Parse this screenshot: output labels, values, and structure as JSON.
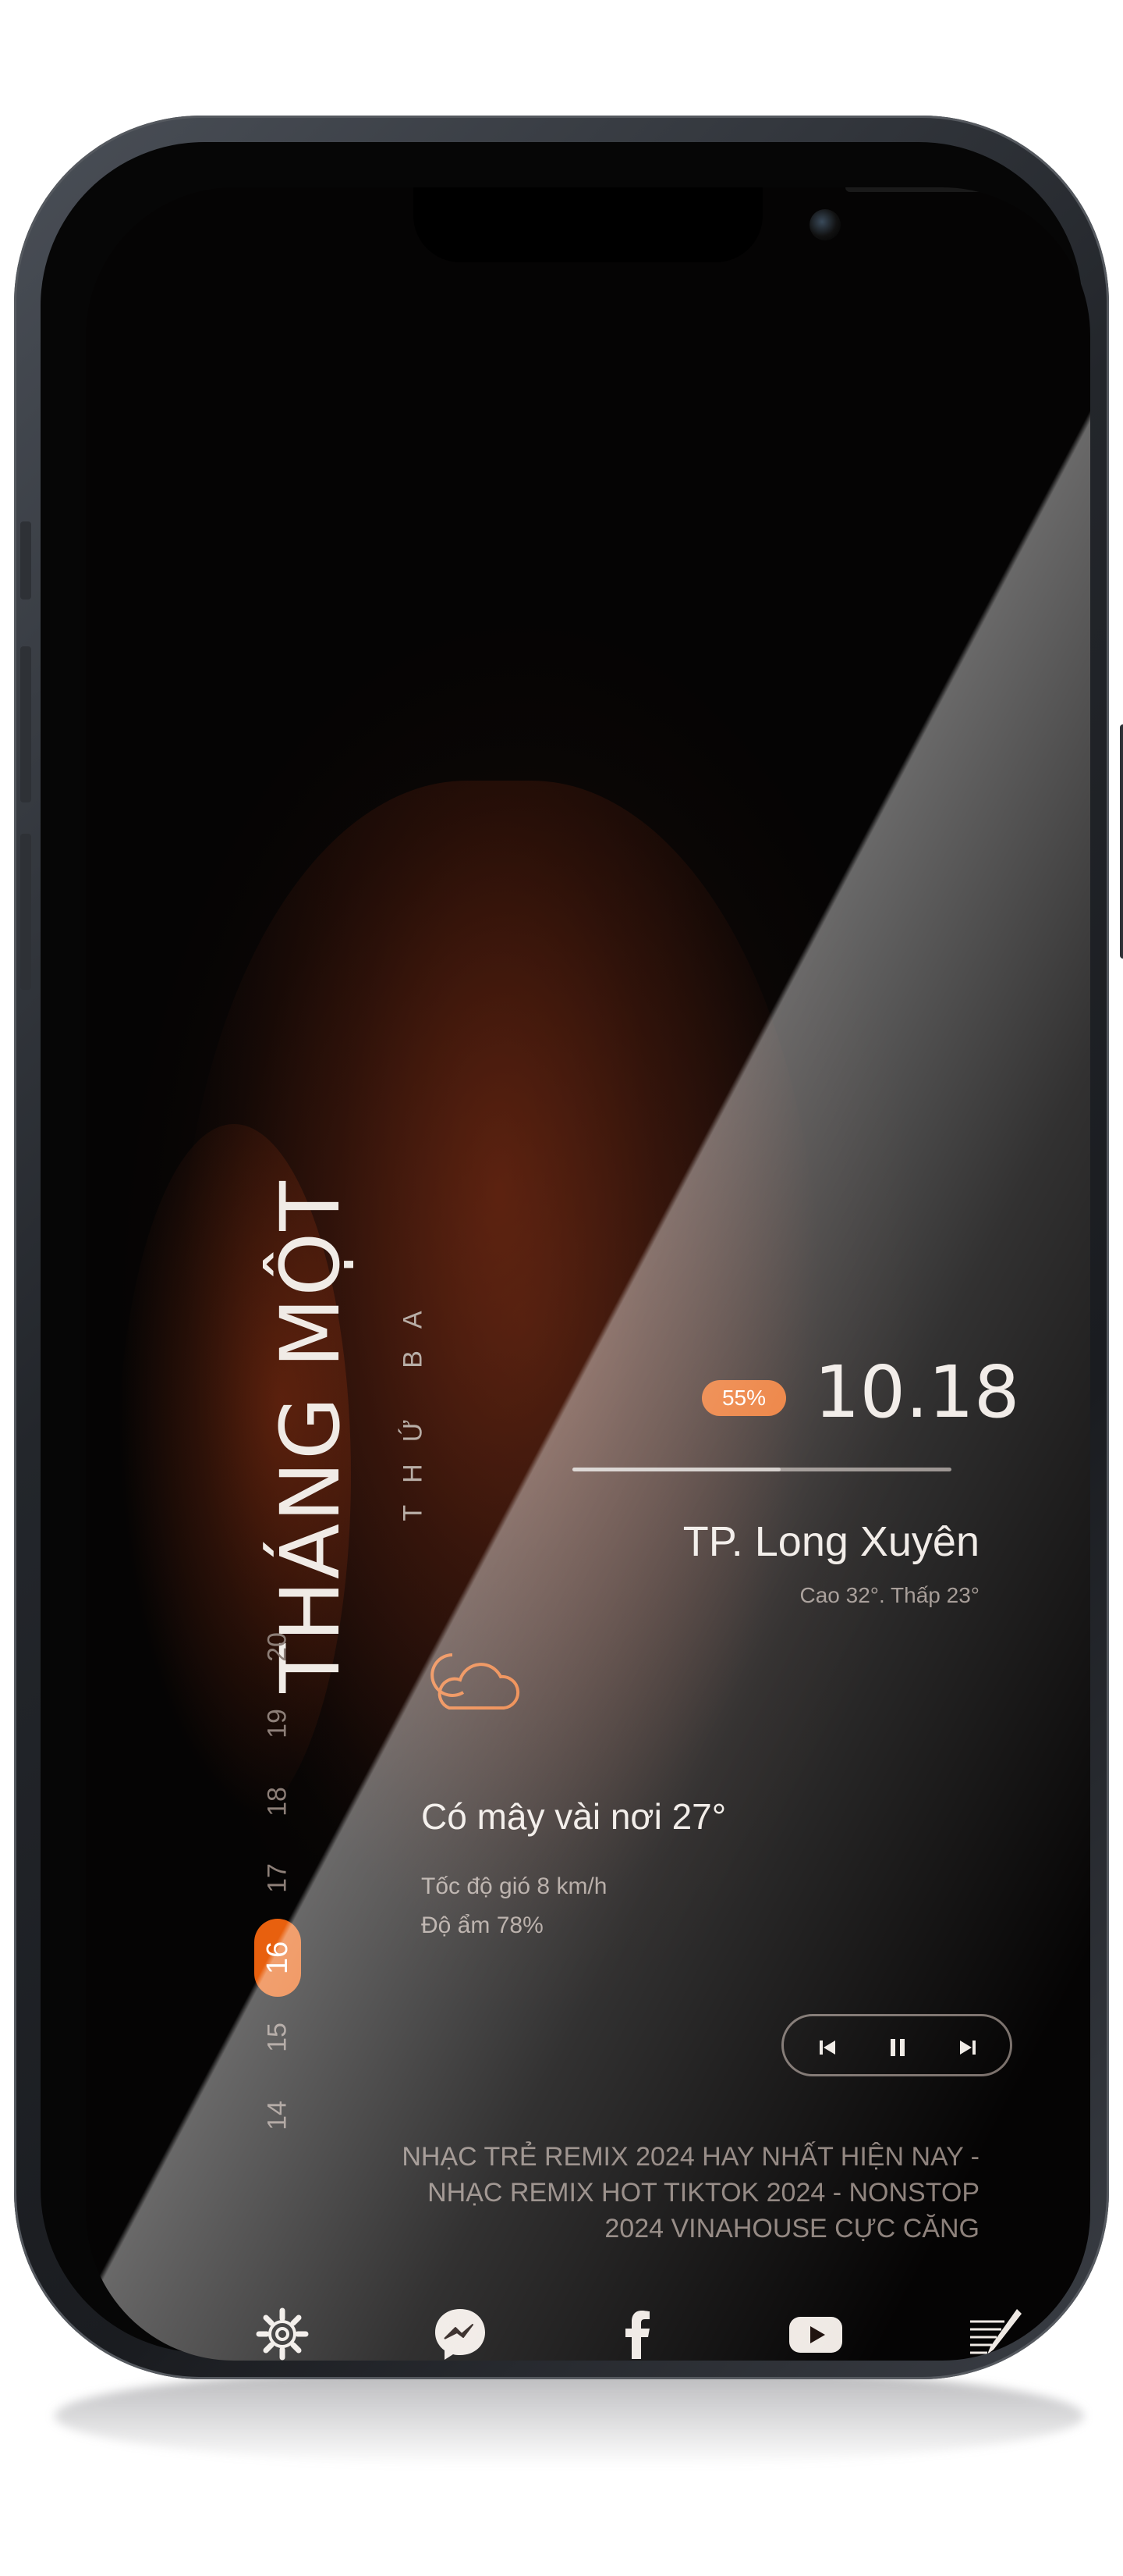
{
  "calendar": {
    "month": "THÁNG MỘT",
    "weekday": "THỨ BA",
    "days": [
      "14",
      "15",
      "16",
      "17",
      "18",
      "19",
      "20"
    ],
    "active_day": "16"
  },
  "status": {
    "battery": "55%",
    "time": "10.18",
    "battery_fraction": 0.55
  },
  "weather": {
    "city": "TP. Long Xuyên",
    "high_low": "Cao 32°. Thấp 23°",
    "condition": "Có mây vài nơi 27°",
    "wind": "Tốc độ gió 8 km/h",
    "humidity": "Độ ẩm 78%",
    "icon": "partly-cloudy-icon"
  },
  "player": {
    "prev_icon": "skip-previous-icon",
    "pause_icon": "pause-icon",
    "next_icon": "skip-next-icon",
    "song_title": "NHẠC TRẺ REMIX 2024 HAY NHẤT HIỆN NAY - NHẠC REMIX HOT TIKTOK 2024 - NONSTOP 2024 VINAHOUSE CỰC CĂNG"
  },
  "dock": [
    {
      "name": "settings",
      "icon": "gear-icon"
    },
    {
      "name": "messenger",
      "icon": "messenger-icon"
    },
    {
      "name": "facebook",
      "icon": "facebook-icon"
    },
    {
      "name": "youtube",
      "icon": "youtube-icon"
    },
    {
      "name": "notes",
      "icon": "notes-icon"
    }
  ],
  "colors": {
    "accent": "#e8600e",
    "text": "#efe9e4",
    "muted": "#8d817b"
  }
}
